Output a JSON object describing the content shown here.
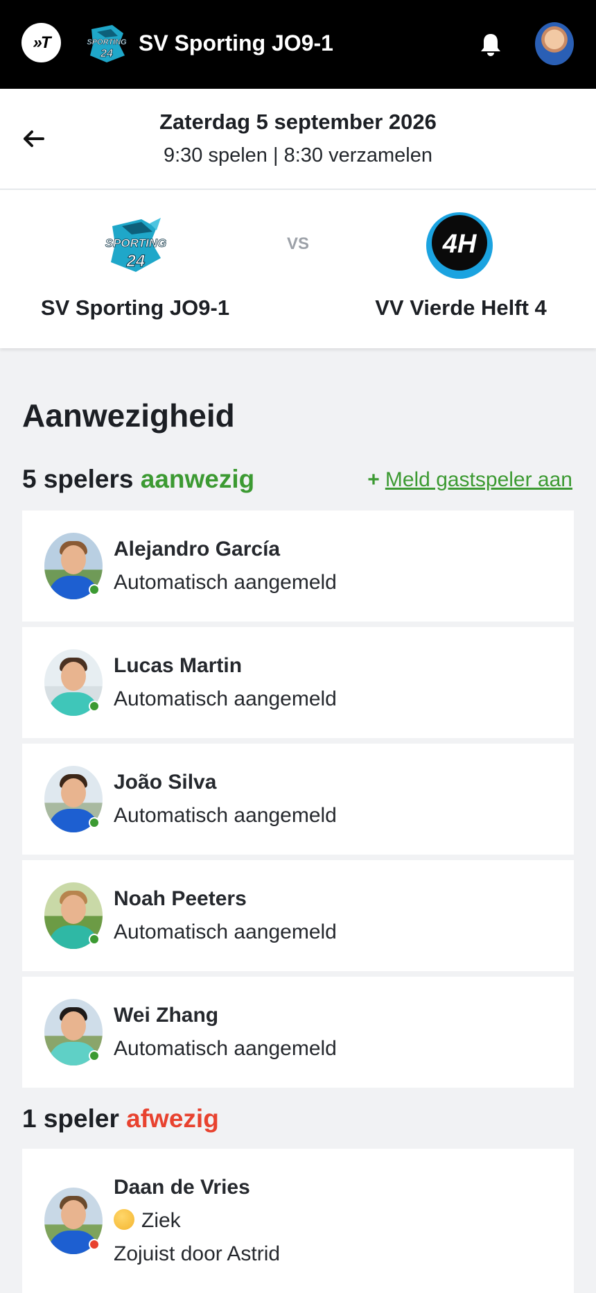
{
  "topbar": {
    "app_logo_text": "»T",
    "team_title": "SV Sporting JO9-1",
    "bell_icon": "bell-icon",
    "avatar_icon": "user-avatar"
  },
  "match_header": {
    "date": "Zaterdag 5 september 2026",
    "times": "9:30 spelen | 8:30 verzamelen",
    "back_icon": "arrow-left-icon"
  },
  "match": {
    "home_team": "SV Sporting JO9-1",
    "vs": "VS",
    "away_team": "VV Vierde Helft 4",
    "away_logo_text": "4H"
  },
  "attendance": {
    "title": "Aanwezigheid",
    "present_count": "5 spelers",
    "present_word": "aanwezig",
    "guest_plus": "+",
    "guest_link": "Meld gastspeler aan",
    "absent_count": "1 speler",
    "absent_word": "afwezig",
    "present_players": [
      {
        "name": "Alejandro García",
        "status": "Automatisch aangemeld"
      },
      {
        "name": "Lucas Martin",
        "status": "Automatisch aangemeld"
      },
      {
        "name": "João Silva",
        "status": "Automatisch aangemeld"
      },
      {
        "name": "Noah Peeters",
        "status": "Automatisch aangemeld"
      },
      {
        "name": "Wei Zhang",
        "status": "Automatisch aangemeld"
      }
    ],
    "absent_players": [
      {
        "name": "Daan de Vries",
        "status": "Ziek",
        "note": "Zojuist door Astrid",
        "emoji_icon": "sick-face-emoji"
      }
    ]
  },
  "colors": {
    "present": "#3c9a32",
    "absent": "#e8422f",
    "topbar": "#000000"
  }
}
